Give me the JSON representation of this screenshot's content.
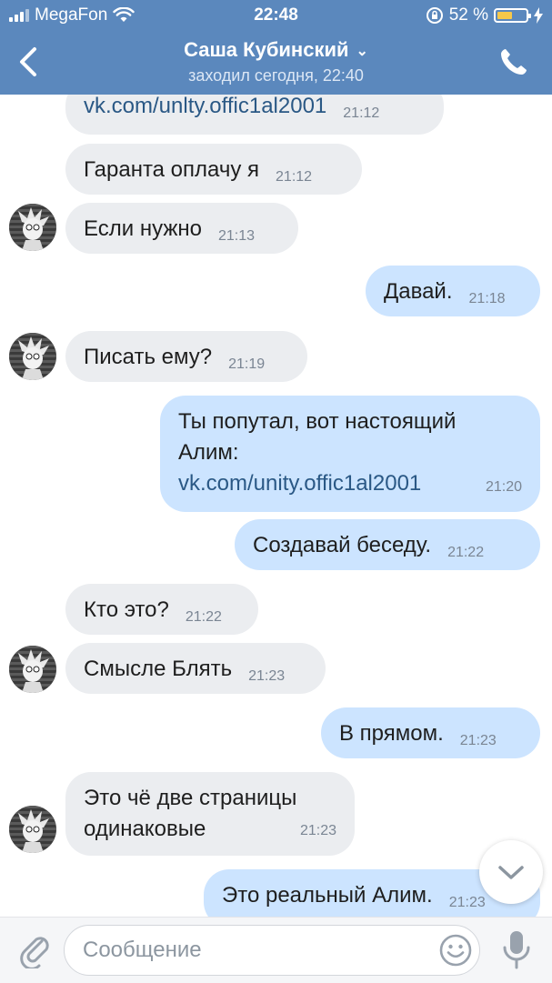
{
  "status_bar": {
    "carrier": "MegaFon",
    "time": "22:48",
    "battery_percent": "52 %",
    "battery_level": 0.52
  },
  "header": {
    "name": "Саша Кубинский",
    "subtitle": "заходил сегодня, 22:40"
  },
  "messages": [
    {
      "dir": "in",
      "text": "vk.com/unlty.offic1al2001",
      "time": "21:12",
      "link": true
    },
    {
      "dir": "in",
      "text": "Гаранта оплачу я",
      "time": "21:12"
    },
    {
      "dir": "in",
      "text": "Если нужно",
      "time": "21:13",
      "avatar": true
    },
    {
      "dir": "out",
      "text": "Давай.",
      "time": "21:18"
    },
    {
      "dir": "in",
      "text": "Писать ему?",
      "time": "21:19",
      "avatar": true
    },
    {
      "dir": "out",
      "line1": "Ты попутал, вот настоящий",
      "line2": "Алим:",
      "link_text": "vk.com/unity.offic1al2001",
      "time": "21:20"
    },
    {
      "dir": "out",
      "text": "Создавай беседу.",
      "time": "21:22"
    },
    {
      "dir": "in",
      "text": "Кто это?",
      "time": "21:22"
    },
    {
      "dir": "in",
      "text": "Смысле Блять",
      "time": "21:23",
      "avatar": true
    },
    {
      "dir": "out",
      "text": "В прямом.",
      "time": "21:23"
    },
    {
      "dir": "in",
      "line1": "Это чё две страницы",
      "line2": "одинаковые",
      "time": "21:23",
      "avatar": true
    },
    {
      "dir": "out",
      "text": "Это реальный Алим.",
      "time": "21:23"
    }
  ],
  "composer": {
    "placeholder": "Сообщение"
  },
  "icons": [
    "back-chevron-icon",
    "dropdown-chevron-icon",
    "phone-icon",
    "attach-icon",
    "emoji-icon",
    "microphone-icon",
    "chevron-down-icon"
  ],
  "colors": {
    "header_bg": "#5b88bd",
    "incoming_bubble": "#ebedf0",
    "outgoing_bubble": "#cce4ff",
    "link": "#2a5885"
  }
}
